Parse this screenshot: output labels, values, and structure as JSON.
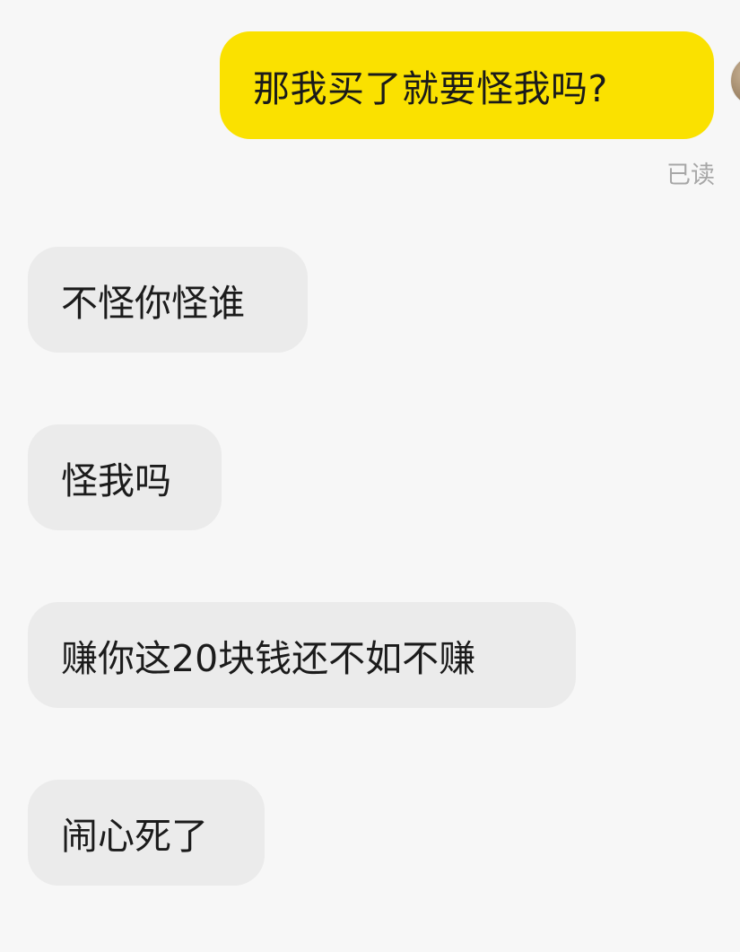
{
  "chat": {
    "outgoing": {
      "text": "那我买了就要怪我吗?",
      "status": "已读"
    },
    "incoming": [
      {
        "text": "不怪你怪谁"
      },
      {
        "text": "怪我吗"
      },
      {
        "text": "赚你这20块钱还不如不赚"
      },
      {
        "text": "闹心死了"
      }
    ]
  },
  "colors": {
    "background": "#f7f7f7",
    "outgoing_bubble": "#fae100",
    "incoming_bubble": "#ebebeb",
    "text": "#1b1b1b",
    "read_receipt": "#a7a7a7"
  }
}
